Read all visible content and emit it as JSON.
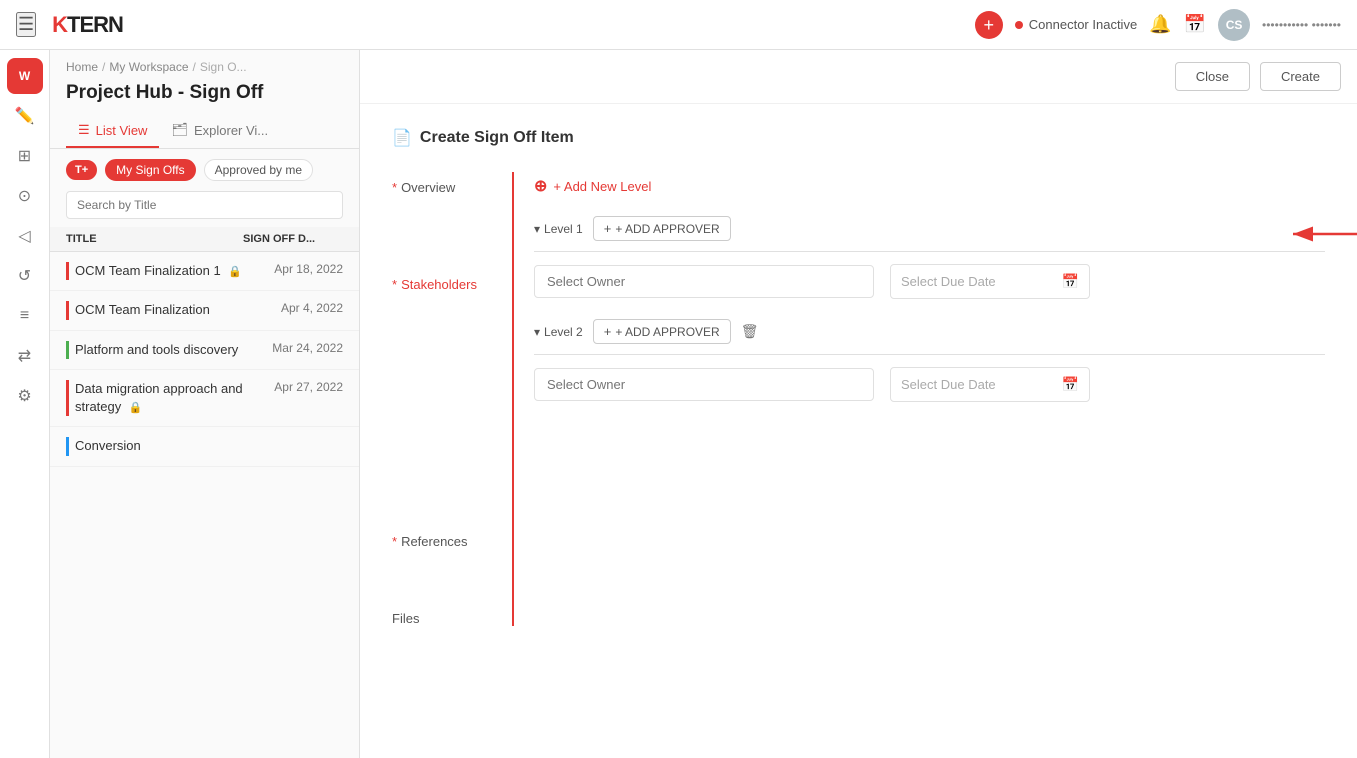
{
  "navbar": {
    "hamburger": "☰",
    "logo_k": "K",
    "logo_tern": "TERN",
    "add_icon": "+",
    "connector_status": "Connector Inactive",
    "bell_icon": "🔔",
    "calendar_icon": "📅",
    "avatar_text": "CS",
    "user_name": "••••••••••• •••••••"
  },
  "sidebar": {
    "icons": [
      "☰",
      "✏️",
      "⊞",
      "⊙",
      "◁",
      "↺",
      "≡",
      "⇄",
      "⚙"
    ]
  },
  "breadcrumb": {
    "home": "Home",
    "separator1": "/",
    "workspace": "My Workspace",
    "separator2": "/",
    "current": "Sign O..."
  },
  "page": {
    "title": "Project Hub - Sign Off"
  },
  "tabs": [
    {
      "id": "list",
      "label": "List View",
      "active": true
    },
    {
      "id": "explorer",
      "label": "Explorer Vi...",
      "active": false
    }
  ],
  "filters": [
    {
      "label": "T+",
      "type": "orange-pill"
    },
    {
      "label": "My Sign Offs",
      "type": "orange"
    },
    {
      "label": "Approved by me",
      "type": "outline"
    }
  ],
  "search": {
    "placeholder": "Search by Title"
  },
  "table_columns": [
    {
      "label": "Title"
    },
    {
      "label": "Sign Off D..."
    }
  ],
  "items": [
    {
      "title": "OCM Team Finalization 1",
      "has_lock": true,
      "date": "Apr 18, 2022",
      "border": "red"
    },
    {
      "title": "OCM Team Finalization",
      "has_lock": false,
      "date": "Apr 4, 2022",
      "border": "red"
    },
    {
      "title": "Platform and tools discovery",
      "has_lock": false,
      "date": "Mar 24, 2022",
      "border": "green"
    },
    {
      "title": "Data migration approach and strategy",
      "has_lock": true,
      "date": "Apr 27, 2022",
      "border": "red"
    },
    {
      "title": "Conversion",
      "has_lock": false,
      "date": "",
      "border": "blue"
    }
  ],
  "dialog": {
    "title": "Create Sign Off Item",
    "title_icon": "📄",
    "close_label": "Close",
    "create_label": "Create",
    "form": {
      "overview_label": "Overview",
      "stakeholders_label": "Stakeholders",
      "references_label": "References",
      "files_label": "Files",
      "required_star": "*",
      "add_level_label": "+ Add New Level",
      "levels": [
        {
          "id": 1,
          "label": "Level 1",
          "add_approver_label": "+ ADD APPROVER",
          "select_owner_placeholder": "Select Owner",
          "select_date_placeholder": "Select Due Date"
        },
        {
          "id": 2,
          "label": "Level 2",
          "add_approver_label": "+ ADD APPROVER",
          "select_owner_placeholder": "Select Owner",
          "select_date_placeholder": "Select Due Date"
        }
      ]
    }
  }
}
